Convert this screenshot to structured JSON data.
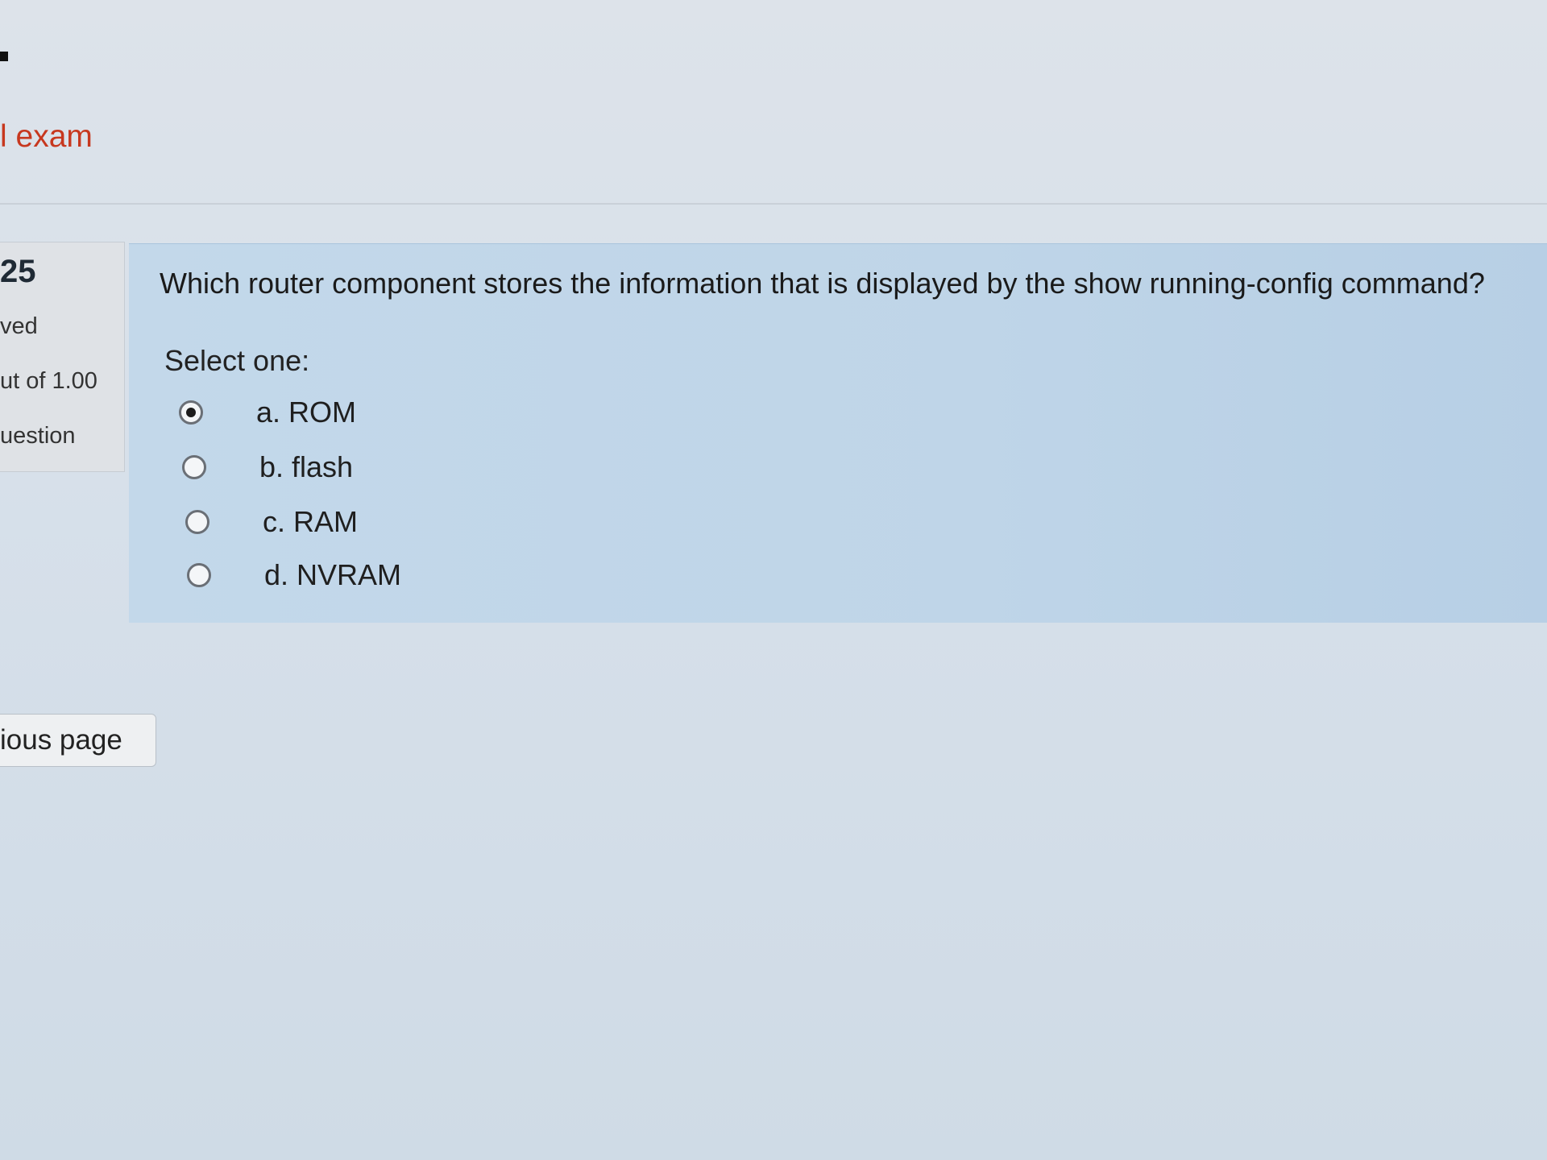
{
  "header": {
    "exam_title": "l exam"
  },
  "question_info": {
    "number": "25",
    "status": "ved",
    "marks": "ut of 1.00",
    "flag_label": "uestion"
  },
  "question": {
    "text": "Which router component stores the information that is displayed by the show running-config command?",
    "prompt": "Select one:",
    "options": [
      {
        "label": "a. ROM",
        "selected": true
      },
      {
        "label": "b. flash",
        "selected": false
      },
      {
        "label": "c. RAM",
        "selected": false
      },
      {
        "label": "d. NVRAM",
        "selected": false
      }
    ]
  },
  "navigation": {
    "previous_label": "ious page"
  }
}
